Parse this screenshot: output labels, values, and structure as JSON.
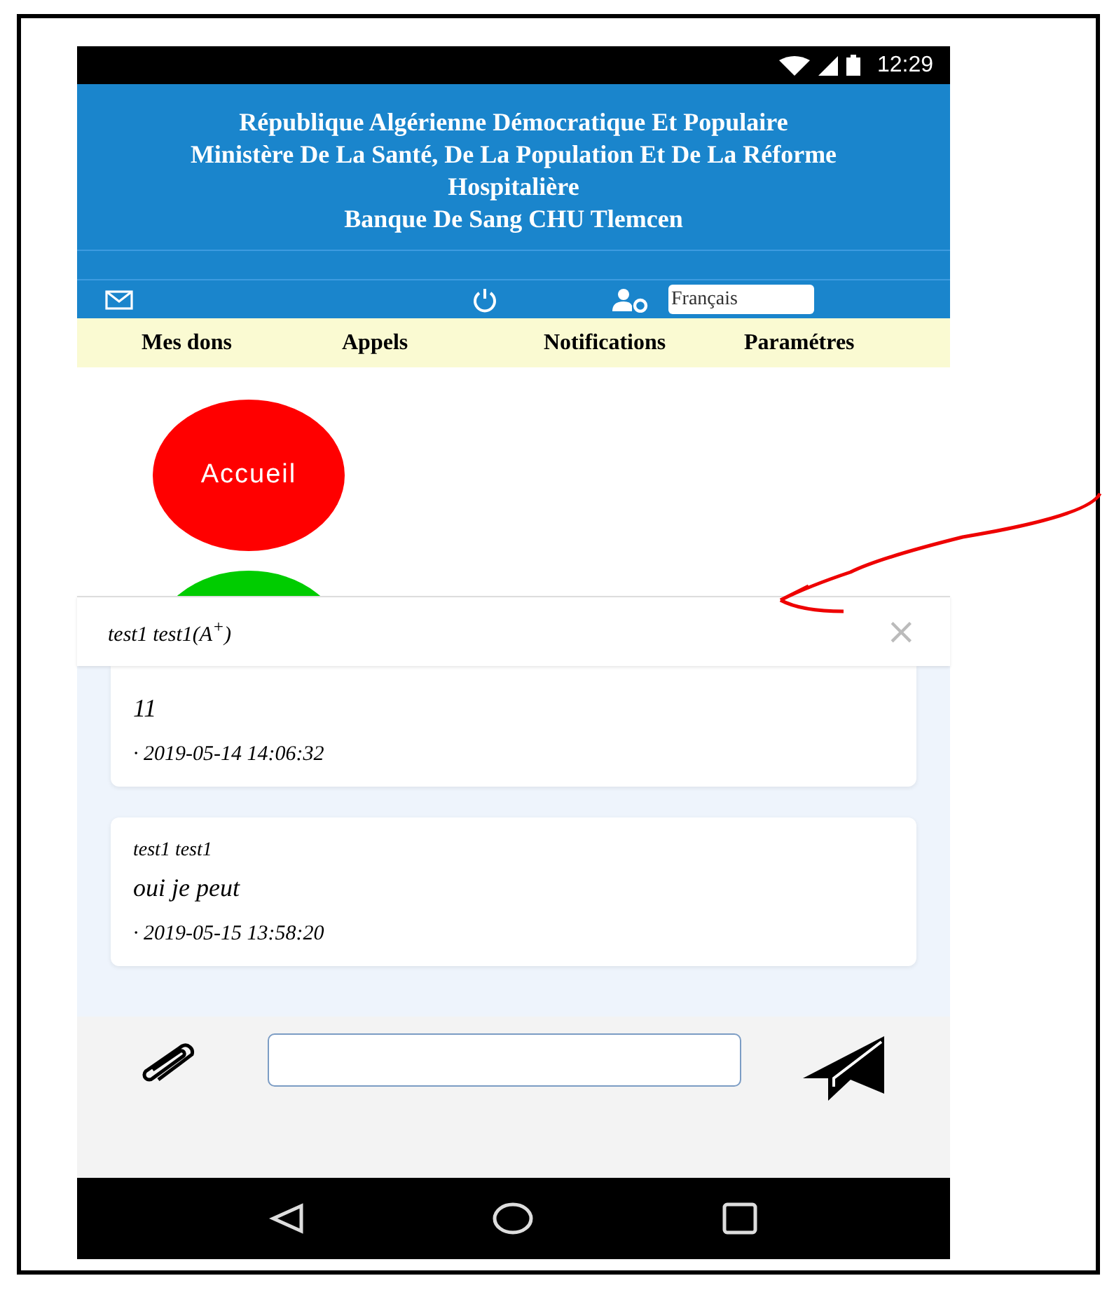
{
  "status_bar": {
    "time": "12:29"
  },
  "header": {
    "lines": [
      "République Algérienne Démocratique Et Populaire",
      "Ministère De La Santé, De La Population Et De La Réforme Hospitalière",
      "Banque De Sang CHU Tlemcen"
    ]
  },
  "toolbar": {
    "language": "Français"
  },
  "tabs": [
    {
      "label": "Mes dons"
    },
    {
      "label": "Appels"
    },
    {
      "label": "Notifications"
    },
    {
      "label": "Paramétres"
    }
  ],
  "home_buttons": [
    {
      "label": "Accueil",
      "color": "#ff0000"
    },
    {
      "color": "#00cc00"
    }
  ],
  "chat": {
    "title": "test1 test1(A$^{+}$)",
    "close": "×",
    "messages": [
      {
        "text": "11",
        "time": "· 2019-05-14 14:06:32"
      },
      {
        "sender": "test1 test1",
        "text": "oui je peut",
        "time": "· 2019-05-15 13:58:20"
      }
    ]
  }
}
